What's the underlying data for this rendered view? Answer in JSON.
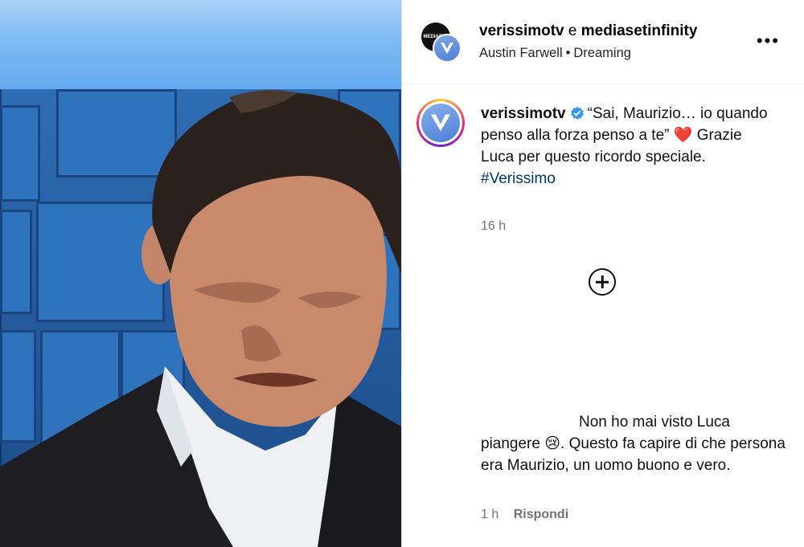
{
  "post": {
    "author_primary": "verissimotv",
    "author_conjunction": "e",
    "author_secondary": "mediasetinfinity",
    "audio_artist": "Austin Farwell",
    "audio_separator": "•",
    "audio_track": "Dreaming",
    "more_label": "•••",
    "back_avatar_text": "MEDIASET"
  },
  "caption": {
    "username": "verissimotv",
    "text": "“Sai, Maurizio… io quando penso alla forza penso a te” ❤️ Grazie Luca per questo ricordo speciale.",
    "hashtag": "#Verissimo",
    "time": "16 h"
  },
  "comment": {
    "text": "Non ho mai visto Luca piangere 😢. Questo fa capire di che persona era Maurizio, un uomo buono e vero.",
    "time": "1 h",
    "reply_label": "Rispondi"
  },
  "colors": {
    "verified": "#3897f0",
    "hashtag": "#00376b",
    "meta_gray": "#737373",
    "sky_blue": "#7fbaf2",
    "studio_blue": "#2f6db3"
  },
  "icons": {
    "verified": "verified-badge-icon",
    "more": "more-options-icon",
    "add": "plus-circle-icon"
  }
}
